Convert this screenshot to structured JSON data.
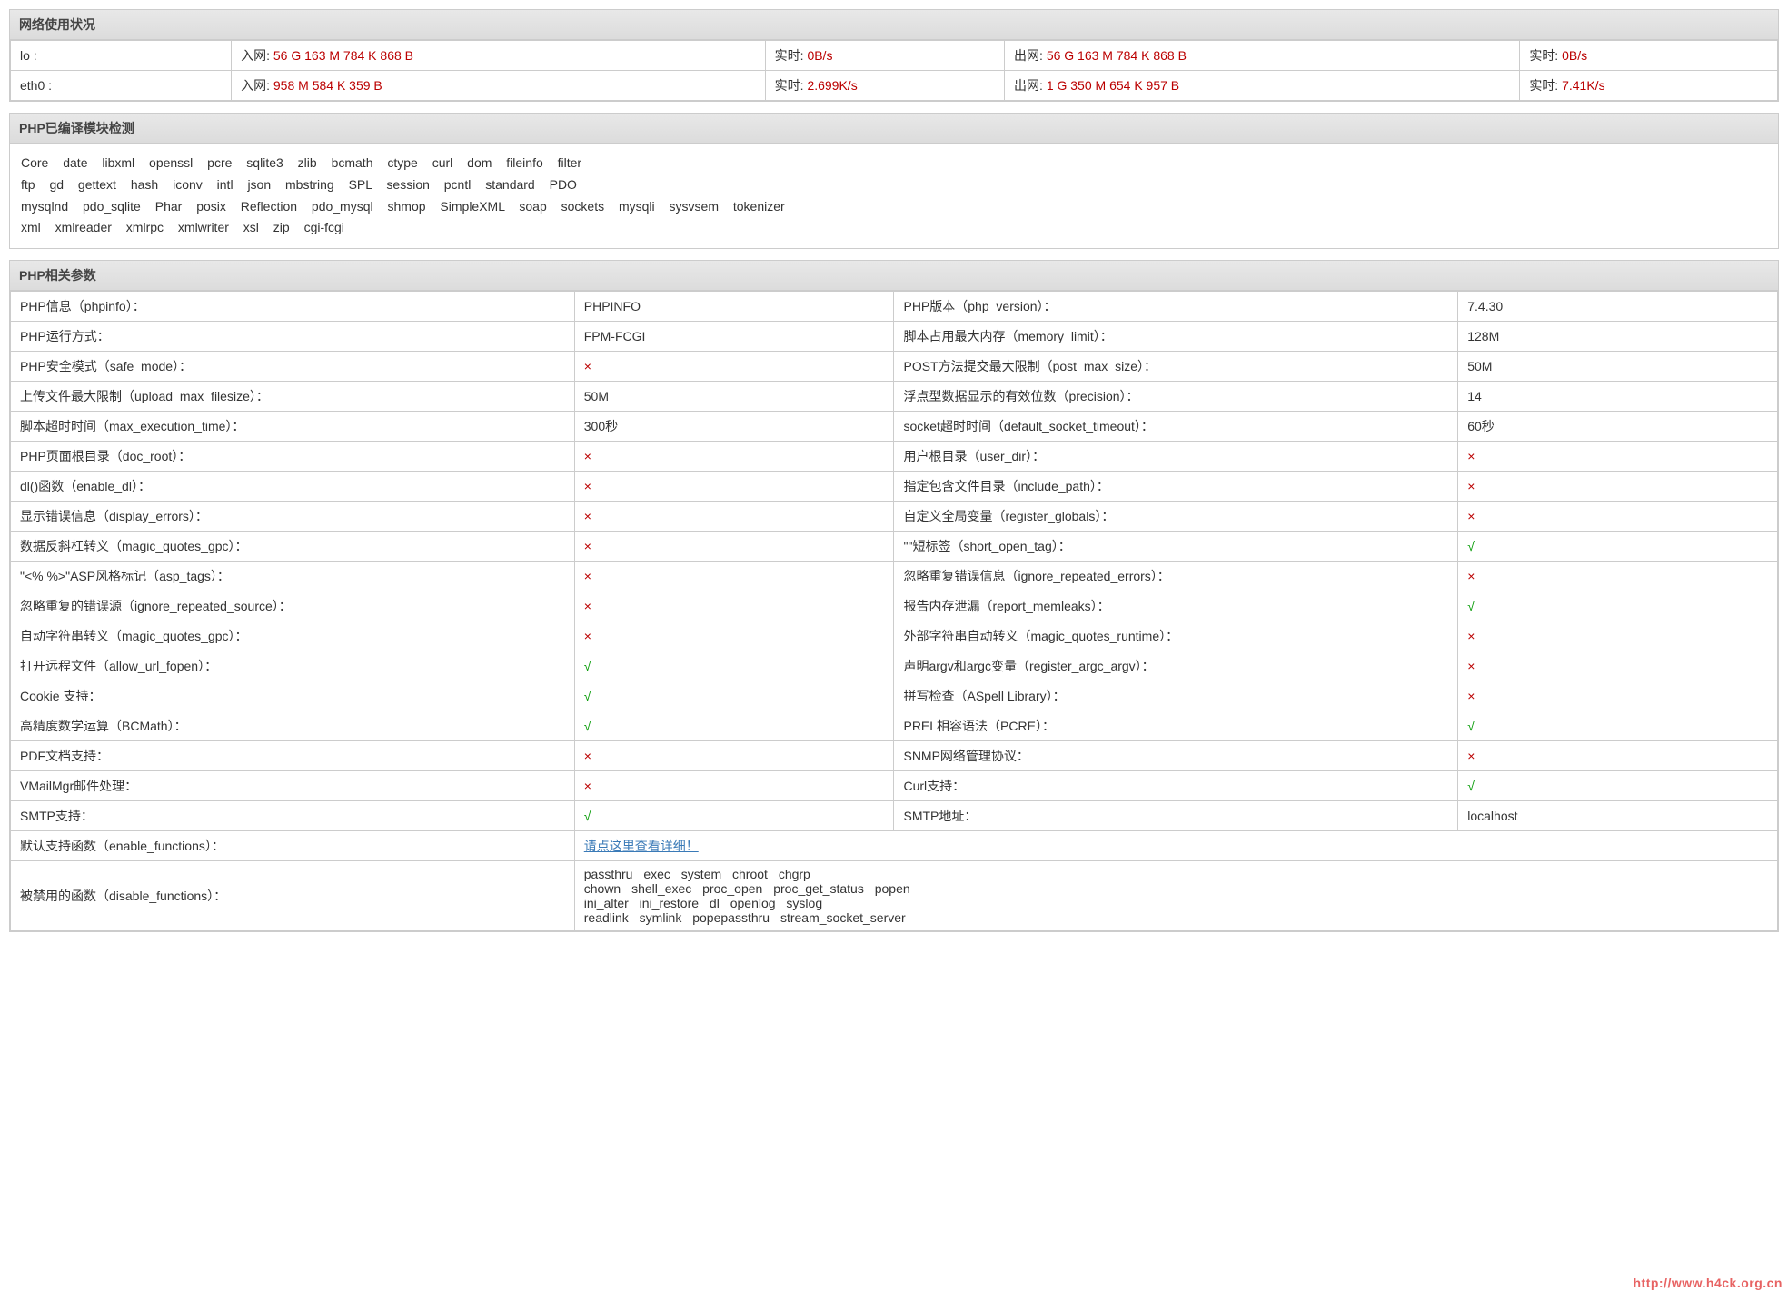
{
  "network": {
    "title": "网络使用状况",
    "labels": {
      "in": "入网:",
      "rt": "实时:",
      "out": "出网:"
    },
    "rows": [
      {
        "iface": "lo :",
        "in": "56 G 163 M 784 K 868 B",
        "rt_in": "0B/s",
        "out": "56 G 163 M 784 K 868 B",
        "rt_out": "0B/s"
      },
      {
        "iface": "eth0 :",
        "in": "958 M 584 K 359 B",
        "rt_in": "2.699K/s",
        "out": "1 G 350 M 654 K 957 B",
        "rt_out": "7.41K/s"
      }
    ]
  },
  "modules": {
    "title": "PHP已编译模块检测",
    "lines": [
      "Core date libxml openssl pcre sqlite3 zlib bcmath ctype curl dom fileinfo filter",
      "ftp gd gettext hash iconv intl json mbstring SPL session pcntl standard PDO",
      "mysqlnd pdo_sqlite Phar posix Reflection pdo_mysql shmop SimpleXML soap sockets mysqli sysvsem tokenizer",
      "xml xmlreader xmlrpc xmlwriter xsl zip cgi-fcgi"
    ]
  },
  "params": {
    "title": "PHP相关参数",
    "rows": [
      [
        {
          "k": "PHP信息（phpinfo）：",
          "t": "plain"
        },
        {
          "v": "PHPINFO",
          "t": "plain"
        },
        {
          "k": "PHP版本（php_version）：",
          "t": "plain"
        },
        {
          "v": "7.4.30",
          "t": "plain"
        }
      ],
      [
        {
          "k": "PHP运行方式：",
          "t": "plain"
        },
        {
          "v": "FPM-FCGI",
          "t": "plain"
        },
        {
          "k": "脚本占用最大内存（memory_limit）：",
          "t": "plain"
        },
        {
          "v": "128M",
          "t": "plain"
        }
      ],
      [
        {
          "k": "PHP安全模式（safe_mode）：",
          "t": "plain"
        },
        {
          "v": "×",
          "t": "red"
        },
        {
          "k": "POST方法提交最大限制（post_max_size）：",
          "t": "plain"
        },
        {
          "v": "50M",
          "t": "plain"
        }
      ],
      [
        {
          "k": "上传文件最大限制（upload_max_filesize）：",
          "t": "plain"
        },
        {
          "v": "50M",
          "t": "plain"
        },
        {
          "k": "浮点型数据显示的有效位数（precision）：",
          "t": "plain"
        },
        {
          "v": "14",
          "t": "plain"
        }
      ],
      [
        {
          "k": "脚本超时时间（max_execution_time）：",
          "t": "plain"
        },
        {
          "v": "300秒",
          "t": "plain"
        },
        {
          "k": "socket超时时间（default_socket_timeout）：",
          "t": "plain"
        },
        {
          "v": "60秒",
          "t": "plain"
        }
      ],
      [
        {
          "k": "PHP页面根目录（doc_root）：",
          "t": "plain"
        },
        {
          "v": "×",
          "t": "red"
        },
        {
          "k": "用户根目录（user_dir）：",
          "t": "plain"
        },
        {
          "v": "×",
          "t": "red"
        }
      ],
      [
        {
          "k": "dl()函数（enable_dl）：",
          "t": "plain"
        },
        {
          "v": "×",
          "t": "red"
        },
        {
          "k": "指定包含文件目录（include_path）：",
          "t": "plain"
        },
        {
          "v": "×",
          "t": "red"
        }
      ],
      [
        {
          "k": "显示错误信息（display_errors）：",
          "t": "plain"
        },
        {
          "v": "×",
          "t": "red"
        },
        {
          "k": "自定义全局变量（register_globals）：",
          "t": "plain"
        },
        {
          "v": "×",
          "t": "red"
        }
      ],
      [
        {
          "k": "数据反斜杠转义（magic_quotes_gpc）：",
          "t": "plain"
        },
        {
          "v": "×",
          "t": "red"
        },
        {
          "k": "\"<?...?>\"短标签（short_open_tag）：",
          "t": "plain"
        },
        {
          "v": "√",
          "t": "green"
        }
      ],
      [
        {
          "k": "\"<% %>\"ASP风格标记（asp_tags）：",
          "t": "plain"
        },
        {
          "v": "×",
          "t": "red"
        },
        {
          "k": "忽略重复错误信息（ignore_repeated_errors）：",
          "t": "plain"
        },
        {
          "v": "×",
          "t": "red"
        }
      ],
      [
        {
          "k": "忽略重复的错误源（ignore_repeated_source）：",
          "t": "plain"
        },
        {
          "v": "×",
          "t": "red"
        },
        {
          "k": "报告内存泄漏（report_memleaks）：",
          "t": "plain"
        },
        {
          "v": "√",
          "t": "green"
        }
      ],
      [
        {
          "k": "自动字符串转义（magic_quotes_gpc）：",
          "t": "plain"
        },
        {
          "v": "×",
          "t": "red"
        },
        {
          "k": "外部字符串自动转义（magic_quotes_runtime）：",
          "t": "plain"
        },
        {
          "v": "×",
          "t": "red"
        }
      ],
      [
        {
          "k": "打开远程文件（allow_url_fopen）：",
          "t": "plain"
        },
        {
          "v": "√",
          "t": "green"
        },
        {
          "k": "声明argv和argc变量（register_argc_argv）：",
          "t": "plain"
        },
        {
          "v": "×",
          "t": "red"
        }
      ],
      [
        {
          "k": "Cookie 支持：",
          "t": "plain"
        },
        {
          "v": "√",
          "t": "green"
        },
        {
          "k": "拼写检查（ASpell Library）：",
          "t": "plain"
        },
        {
          "v": "×",
          "t": "red"
        }
      ],
      [
        {
          "k": "高精度数学运算（BCMath）：",
          "t": "plain"
        },
        {
          "v": "√",
          "t": "green"
        },
        {
          "k": "PREL相容语法（PCRE）：",
          "t": "plain"
        },
        {
          "v": "√",
          "t": "green"
        }
      ],
      [
        {
          "k": "PDF文档支持：",
          "t": "plain"
        },
        {
          "v": "×",
          "t": "red"
        },
        {
          "k": "SNMP网络管理协议：",
          "t": "plain"
        },
        {
          "v": "×",
          "t": "red"
        }
      ],
      [
        {
          "k": "VMailMgr邮件处理：",
          "t": "plain"
        },
        {
          "v": "×",
          "t": "red"
        },
        {
          "k": "Curl支持：",
          "t": "plain"
        },
        {
          "v": "√",
          "t": "green"
        }
      ],
      [
        {
          "k": "SMTP支持：",
          "t": "plain"
        },
        {
          "v": "√",
          "t": "green"
        },
        {
          "k": "SMTP地址：",
          "t": "plain"
        },
        {
          "v": "localhost",
          "t": "plain"
        }
      ]
    ],
    "enable_functions": {
      "label": "默认支持函数（enable_functions）：",
      "link_text": "请点这里查看详细！"
    },
    "disable_functions": {
      "label": "被禁用的函数（disable_functions）：",
      "lines": [
        "passthru exec system chroot chgrp",
        "chown shell_exec proc_open proc_get_status popen",
        "ini_alter ini_restore dl openlog syslog",
        "readlink symlink popepassthru stream_socket_server"
      ]
    }
  },
  "watermark": "http://www.h4ck.org.cn"
}
